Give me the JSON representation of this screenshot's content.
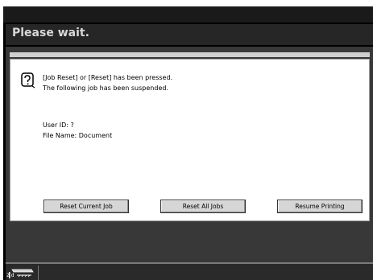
{
  "header": {
    "title": "Please wait."
  },
  "dialog": {
    "message_line_1": "[Job Reset] or [Reset] has been pressed.",
    "message_line_2": "The following job has been suspended.",
    "user_id": "User ID: ?",
    "file_name": "File Name: Document"
  },
  "buttons": {
    "reset_current": "Reset Current Job",
    "reset_all": "Reset All Jobs",
    "resume": "Resume Printing"
  },
  "status_bar": {
    "tray_label": "2 d"
  },
  "icons": {
    "message": "question-document-icon",
    "tray": "paper-tray-icon"
  },
  "colors": {
    "screen_background": "#000000",
    "title_bar": "#262626",
    "body_background": "#383838",
    "panel_background": "#ffffff",
    "button_face": "#d6d6d6"
  }
}
